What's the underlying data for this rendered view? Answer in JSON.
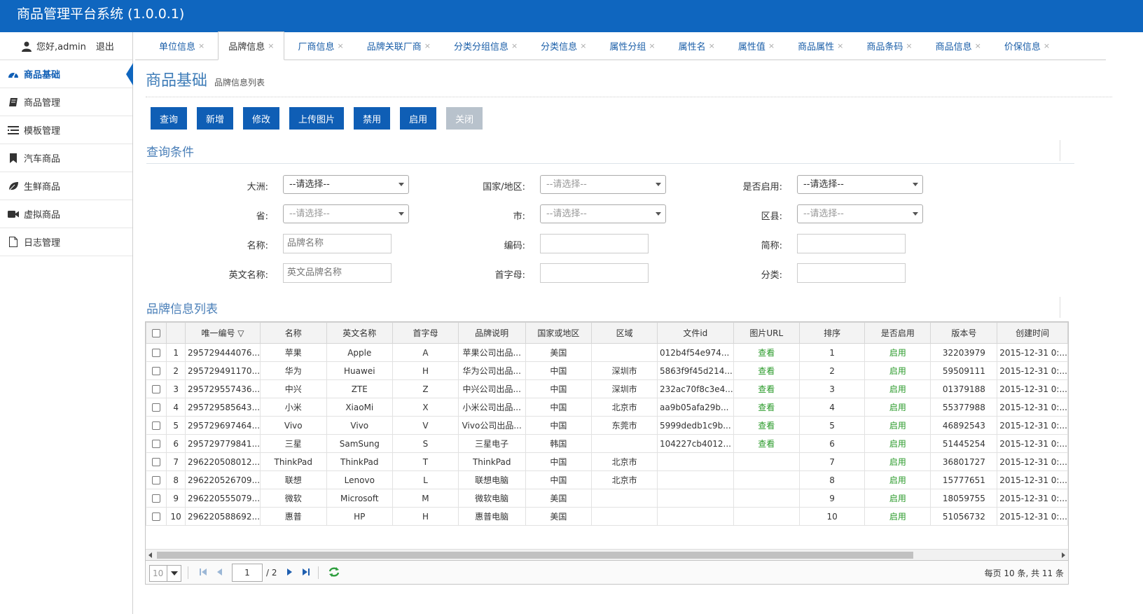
{
  "app": {
    "title": "商品管理平台系统 (1.0.0.1)"
  },
  "user": {
    "greeting": "您好,admin",
    "logout": "退出"
  },
  "sidebar": {
    "items": [
      {
        "label": "商品基础",
        "icon": "dashboard-icon"
      },
      {
        "label": "商品管理",
        "icon": "book-icon"
      },
      {
        "label": "模板管理",
        "icon": "list-icon"
      },
      {
        "label": "汽车商品",
        "icon": "bookmark-icon"
      },
      {
        "label": "生鲜商品",
        "icon": "leaf-icon"
      },
      {
        "label": "虚拟商品",
        "icon": "video-camera-icon"
      },
      {
        "label": "日志管理",
        "icon": "file-icon"
      }
    ]
  },
  "tabs": [
    {
      "label": "单位信息"
    },
    {
      "label": "品牌信息"
    },
    {
      "label": "厂商信息"
    },
    {
      "label": "品牌关联厂商"
    },
    {
      "label": "分类分组信息"
    },
    {
      "label": "分类信息"
    },
    {
      "label": "属性分组"
    },
    {
      "label": "属性名"
    },
    {
      "label": "属性值"
    },
    {
      "label": "商品属性"
    },
    {
      "label": "商品条码"
    },
    {
      "label": "商品信息"
    },
    {
      "label": "价保信息"
    }
  ],
  "tab_close": "×",
  "page": {
    "title": "商品基础",
    "subtitle": "品牌信息列表"
  },
  "toolbar": {
    "query": "查询",
    "add": "新增",
    "edit": "修改",
    "upload": "上传图片",
    "disable": "禁用",
    "enable": "启用",
    "close": "关闭"
  },
  "query": {
    "section_title": "查询条件",
    "continent_label": "大洲:",
    "continent_value": "--请选择--",
    "country_label": "国家/地区:",
    "country_value": "--请选择--",
    "enabled_label": "是否启用:",
    "enabled_value": "--请选择--",
    "province_label": "省:",
    "province_value": "--请选择--",
    "city_label": "市:",
    "city_value": "--请选择--",
    "district_label": "区县:",
    "district_value": "--请选择--",
    "name_label": "名称:",
    "name_placeholder": "品牌名称",
    "code_label": "编码:",
    "short_label": "简称:",
    "en_name_label": "英文名称:",
    "en_name_placeholder": "英文品牌名称",
    "initial_label": "首字母:",
    "category_label": "分类:"
  },
  "list": {
    "section_title": "品牌信息列表",
    "columns": [
      "唯一编号 ▽",
      "名称",
      "英文名称",
      "首字母",
      "品牌说明",
      "国家或地区",
      "区域",
      "文件id",
      "图片URL",
      "排序",
      "是否启用",
      "版本号",
      "创建时间"
    ],
    "rows": [
      {
        "n": "1",
        "id": "295729444076...",
        "name": "苹果",
        "en": "Apple",
        "ini": "A",
        "desc": "苹果公司出品...",
        "country": "美国",
        "region": "",
        "file": "012b4f54e974...",
        "img": "查看",
        "sort": "1",
        "enabled": "启用",
        "ver": "32203979",
        "time": "2015-12-31 0:..."
      },
      {
        "n": "2",
        "id": "295729491170...",
        "name": "华为",
        "en": "Huawei",
        "ini": "H",
        "desc": "华为公司出品...",
        "country": "中国",
        "region": "深圳市",
        "file": "5863f9f45d214...",
        "img": "查看",
        "sort": "2",
        "enabled": "启用",
        "ver": "59509111",
        "time": "2015-12-31 0:..."
      },
      {
        "n": "3",
        "id": "295729557436...",
        "name": "中兴",
        "en": "ZTE",
        "ini": "Z",
        "desc": "中兴公司出品...",
        "country": "中国",
        "region": "深圳市",
        "file": "232ac70f8c3e4...",
        "img": "查看",
        "sort": "3",
        "enabled": "启用",
        "ver": "01379188",
        "time": "2015-12-31 0:..."
      },
      {
        "n": "4",
        "id": "295729585643...",
        "name": "小米",
        "en": "XiaoMi",
        "ini": "X",
        "desc": "小米公司出品...",
        "country": "中国",
        "region": "北京市",
        "file": "aa9b05afa29b...",
        "img": "查看",
        "sort": "4",
        "enabled": "启用",
        "ver": "55377988",
        "time": "2015-12-31 0:..."
      },
      {
        "n": "5",
        "id": "295729697464...",
        "name": "Vivo",
        "en": "Vivo",
        "ini": "V",
        "desc": "Vivo公司出品...",
        "country": "中国",
        "region": "东莞市",
        "file": "5999dedb1c9b...",
        "img": "查看",
        "sort": "5",
        "enabled": "启用",
        "ver": "46892543",
        "time": "2015-12-31 0:..."
      },
      {
        "n": "6",
        "id": "295729779841...",
        "name": "三星",
        "en": "SamSung",
        "ini": "S",
        "desc": "三星电子",
        "country": "韩国",
        "region": "",
        "file": "104227cb4012...",
        "img": "查看",
        "sort": "6",
        "enabled": "启用",
        "ver": "51445254",
        "time": "2015-12-31 0:..."
      },
      {
        "n": "7",
        "id": "296220508012...",
        "name": "ThinkPad",
        "en": "ThinkPad",
        "ini": "T",
        "desc": "ThinkPad",
        "country": "中国",
        "region": "北京市",
        "file": "",
        "img": "",
        "sort": "7",
        "enabled": "启用",
        "ver": "36801727",
        "time": "2015-12-31 0:..."
      },
      {
        "n": "8",
        "id": "296220526709...",
        "name": "联想",
        "en": "Lenovo",
        "ini": "L",
        "desc": "联想电脑",
        "country": "中国",
        "region": "北京市",
        "file": "",
        "img": "",
        "sort": "8",
        "enabled": "启用",
        "ver": "15777651",
        "time": "2015-12-31 0:..."
      },
      {
        "n": "9",
        "id": "296220555079...",
        "name": "微软",
        "en": "Microsoft",
        "ini": "M",
        "desc": "微软电脑",
        "country": "美国",
        "region": "",
        "file": "",
        "img": "",
        "sort": "9",
        "enabled": "启用",
        "ver": "18059755",
        "time": "2015-12-31 0:..."
      },
      {
        "n": "10",
        "id": "296220588692...",
        "name": "惠普",
        "en": "HP",
        "ini": "H",
        "desc": "惠普电脑",
        "country": "美国",
        "region": "",
        "file": "",
        "img": "",
        "sort": "10",
        "enabled": "启用",
        "ver": "51056732",
        "time": "2015-12-31 0:..."
      }
    ]
  },
  "pager": {
    "page_size": "10",
    "current_page": "1",
    "total_pages": "/ 2",
    "info": "每页 10 条, 共 11 条"
  },
  "colors": {
    "primary": "#0f66bf",
    "button": "#0f5eb5",
    "accent_text": "#3f7db8",
    "enabled_green": "#2a9a2a"
  }
}
